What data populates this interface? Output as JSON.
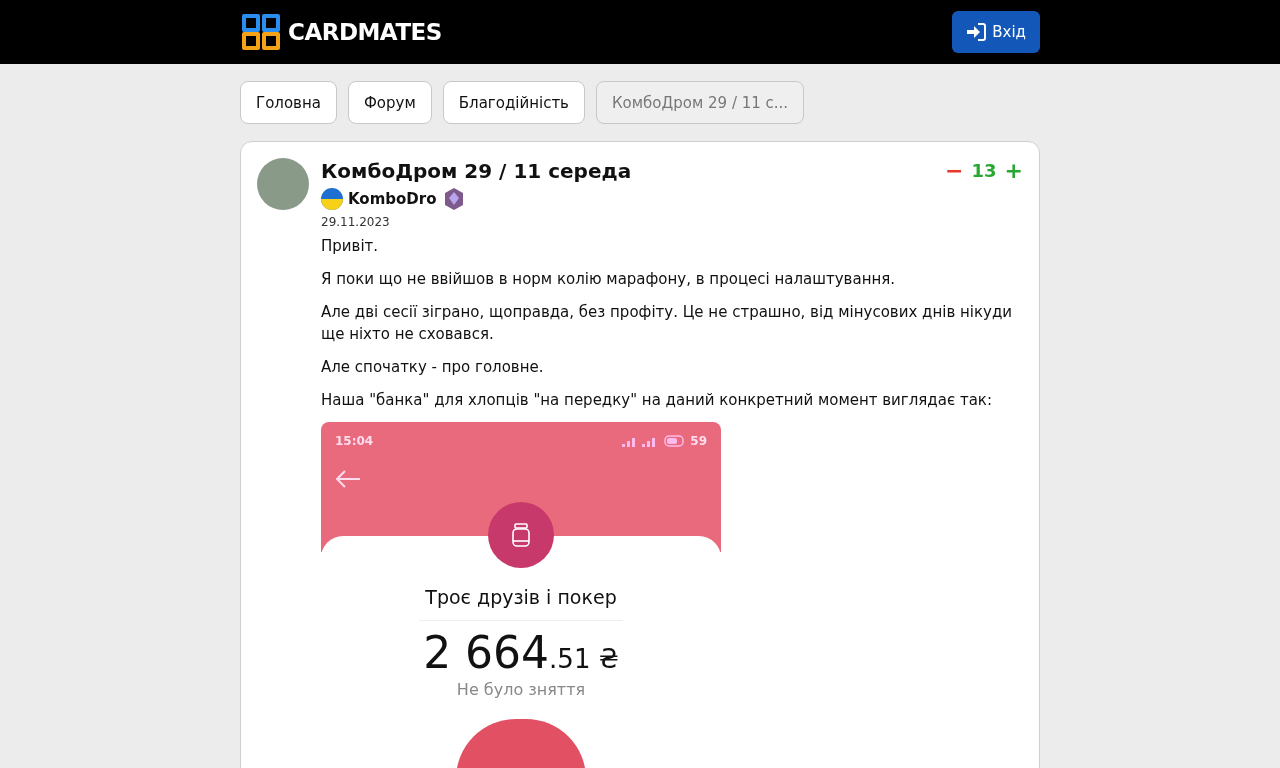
{
  "header": {
    "logo": "CARDMATES",
    "login_button": "Вхід"
  },
  "breadcrumbs": [
    {
      "label": "Головна",
      "current": false
    },
    {
      "label": "Форум",
      "current": false
    },
    {
      "label": "Благодійність",
      "current": false
    },
    {
      "label": "КомбоДром 29 / 11 с...",
      "current": true
    }
  ],
  "post": {
    "title": "КомбоДром 29 / 11 середа",
    "author": "KomboDro",
    "date": "29.11.2023",
    "vote": {
      "down": "−",
      "score": "13",
      "up": "+"
    },
    "paragraphs": [
      "Привіт.",
      "Я поки що не ввійшов в норм колію марафону, в процесі налаштування.",
      "Але дві сесії зіграно, щоправда, без профіту. Це не страшно, від мінусових днів нікуди ще ніхто не сховався.",
      "Але спочатку - про головне.",
      "Наша \"банка\" для хлопців \"на передку\" на  даний конкретний момент виглядає так:"
    ],
    "phone_screenshot": {
      "time": "15:04",
      "battery": "59",
      "jar_name": "Троє друзів і покер",
      "amount_whole": "2 664",
      "amount_fraction": ".51 ₴",
      "note": "Не було зняття"
    }
  }
}
